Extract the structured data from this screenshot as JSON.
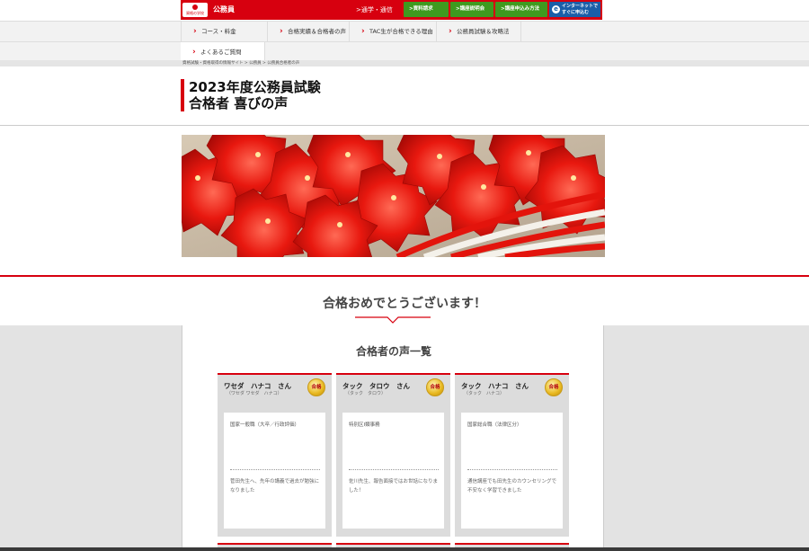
{
  "header": {
    "logo_text": "資格の学校",
    "site_name": "公務員",
    "mode_label": ">通学・通信",
    "buttons": [
      {
        "label": ">資料請求"
      },
      {
        "label": ">講座説明会"
      },
      {
        "label": ">講座申込み方法"
      }
    ],
    "internet_button": {
      "line1": "インターネットで",
      "line2": "すぐに申込む",
      "icon": "e"
    }
  },
  "nav": {
    "items": [
      {
        "label": "コース・料金"
      },
      {
        "label": "合格実績＆合格者の声"
      },
      {
        "label": "TAC生が合格できる理由"
      },
      {
        "label": "公務員試験＆攻略法"
      }
    ],
    "faq": "よくあるご質問"
  },
  "breadcrumb": "資格試験・資格取得の情報サイト > 公務員 > 公務員合格者の声",
  "page_title": {
    "line1": "2023年度公務員試験",
    "line2": "合格者 喜びの声"
  },
  "congrats": "合格おめでとうございます！",
  "list_title": "合格者の声一覧",
  "badge_label": "合格",
  "cards": [
    {
      "name": "ワセダ　ハナコ　さん",
      "kana": "（ワセダ ワセダ　ハナコ）",
      "exam": "国家一般職（大卒／行政評価）",
      "quote": "菅田先生へ、先年の講義で過去が勉強になりました"
    },
    {
      "name": "タック　タロウ　さん",
      "kana": "（タック　タロウ）",
      "exam": "特別区I類事務",
      "quote": "佐川先生、報告面接ではお世話になりました！"
    },
    {
      "name": "タック　ハナコ　さん",
      "kana": "（タック　ハナコ）",
      "exam": "国家総合職（法律区分）",
      "quote": "通信講座でも田先生のカウンセリングで不安なく学習できました"
    }
  ],
  "colors": {
    "brand_red": "#d7000f",
    "button_green": "#3f9a1f",
    "button_blue": "#1a5ea8"
  }
}
